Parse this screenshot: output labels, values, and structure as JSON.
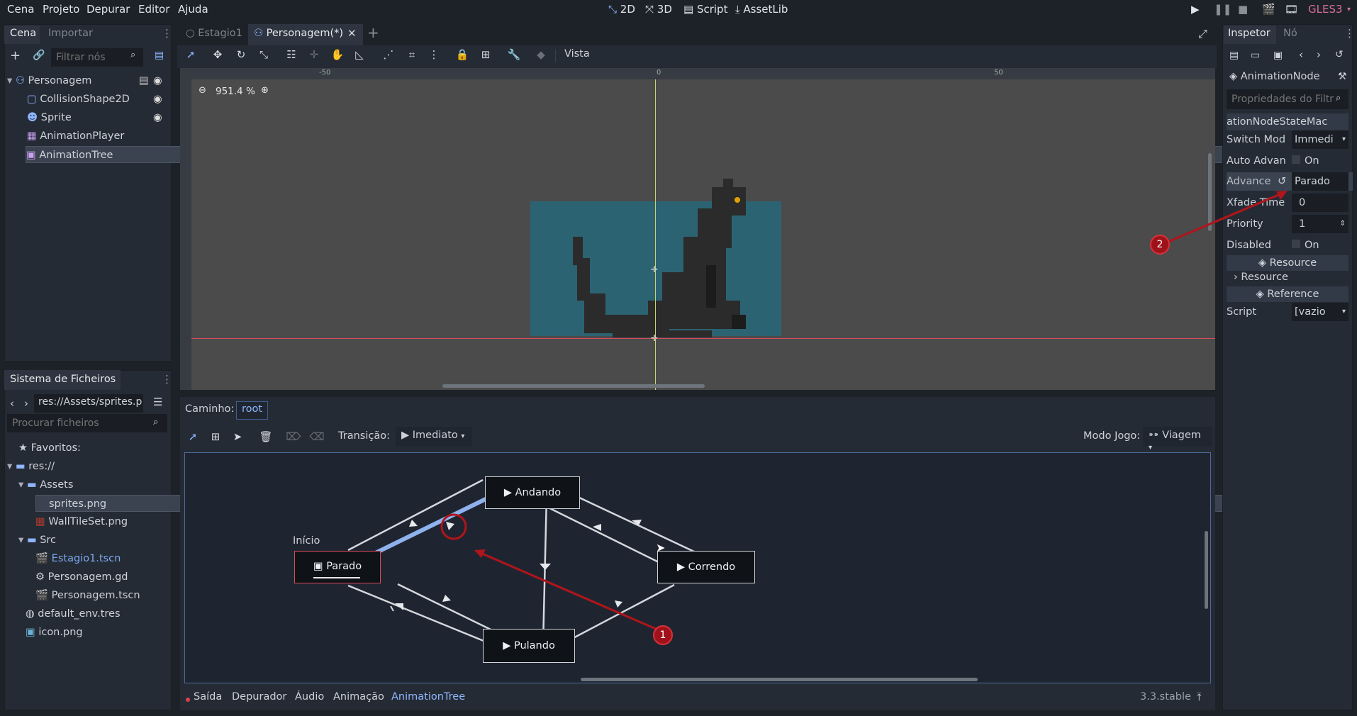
{
  "menu": [
    "Cena",
    "Projeto",
    "Depurar",
    "Editor",
    "Ajuda"
  ],
  "workspaces": [
    "2D",
    "3D",
    "Script",
    "AssetLib"
  ],
  "renderer": "GLES3",
  "scene_dock": {
    "tabs": [
      "Cena",
      "Importar"
    ],
    "filter_placeholder": "Filtrar nós",
    "nodes": [
      "Personagem",
      "CollisionShape2D",
      "Sprite",
      "AnimationPlayer",
      "AnimationTree"
    ]
  },
  "filesystem": {
    "title": "Sistema de Ficheiros",
    "path": "res://Assets/sprites.p",
    "search_placeholder": "Procurar ficheiros",
    "items": [
      "Favoritos:",
      "res://",
      "Assets",
      "sprites.png",
      "WallTileSet.png",
      "Src",
      "Estagio1.tscn",
      "Personagem.gd",
      "Personagem.tscn",
      "default_env.tres",
      "icon.png"
    ]
  },
  "scene_tabs": [
    "Estagio1",
    "Personagem(*)"
  ],
  "toolbar": {
    "view": "Vista"
  },
  "viewport": {
    "zoom": "951.4 %",
    "ruler_labels": [
      "-50",
      "0",
      "50"
    ]
  },
  "animtree": {
    "path_label": "Caminho:",
    "path_value": "root",
    "transition_label": "Transição:",
    "transition_value": "Imediato",
    "play_mode_label": "Modo Jogo:",
    "play_mode_value": "Viagem",
    "start_label": "Início",
    "states": [
      "Andando",
      "Parado",
      "Correndo",
      "Pulando"
    ]
  },
  "callouts": [
    "1",
    "2"
  ],
  "bottom_tabs": [
    "Saída",
    "Depurador",
    "Áudio",
    "Animação",
    "AnimationTree"
  ],
  "version": "3.3.stable",
  "inspector": {
    "tabs": [
      "Inspetor",
      "Nó"
    ],
    "object": "AnimationNode",
    "filter_placeholder": "Propriedades do Filtr",
    "class_header": "ationNodeStateMac",
    "props": [
      {
        "label": "Switch Mod",
        "value": "Immedi"
      },
      {
        "label": "Auto Advan",
        "value": "On"
      },
      {
        "label": "Advance",
        "value": "Parado"
      },
      {
        "label": "Xfade Time",
        "value": "0"
      },
      {
        "label": "Priority",
        "value": "1"
      },
      {
        "label": "Disabled",
        "value": "On"
      }
    ],
    "resource_header": "Resource",
    "resource_sub": "Resource",
    "reference_header": "Reference",
    "script_label": "Script",
    "script_value": "[vazio"
  },
  "colors": {
    "accent": "#6a9cf2",
    "annotation": "#b0151b",
    "viewport_bg": "#4b4b4b",
    "sprite_bg": "#2c6373"
  }
}
